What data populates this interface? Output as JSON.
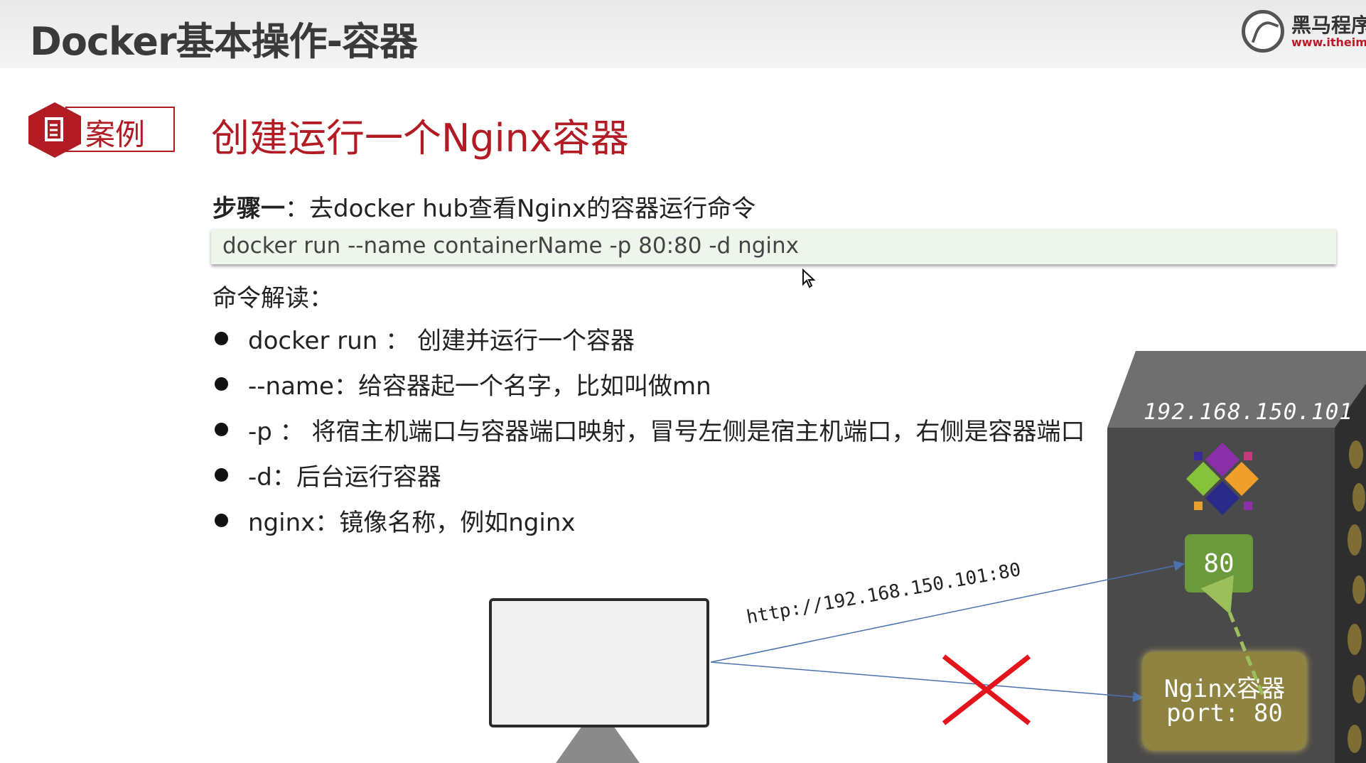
{
  "header": {
    "title": "Docker基本操作-容器",
    "logo": {
      "cn": "黑马程序",
      "url": "www.itheima."
    }
  },
  "slide": {
    "badge_label": "案例",
    "title": "创建运行一个Nginx容器",
    "step": {
      "label": "步骤一",
      "separator": "：",
      "text": "去docker hub查看Nginx的容器运行命令"
    },
    "command": "docker run --name containerName -p 80:80 -d nginx",
    "explain_heading": "命令解读：",
    "bullets": [
      "docker run ： 创建并运行一个容器",
      "--name：给容器起一个名字，比如叫做mn",
      "-p ： 将宿主机端口与容器端口映射，冒号左侧是宿主机端口，右侧是容器端口",
      "-d：后台运行容器",
      "nginx：镜像名称，例如nginx"
    ]
  },
  "diagram": {
    "url_label": "http://192.168.150.101:80",
    "server_ip": "192.168.150.101",
    "host_port": "80",
    "container_name": "Nginx容器",
    "container_port": "port: 80",
    "colors": {
      "accent": "#b31b24",
      "port_box": "#6b9a3c",
      "container": "#8e8340",
      "server": "#4a4a4a",
      "cross": "#e3141c",
      "arrow": "#4a72b0"
    }
  }
}
